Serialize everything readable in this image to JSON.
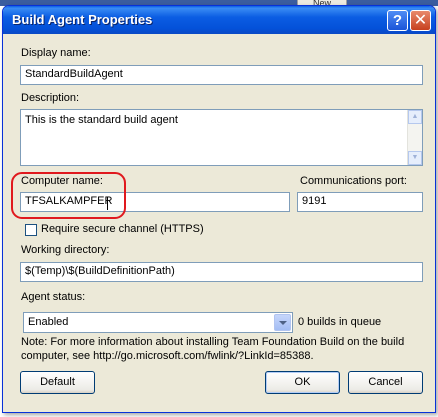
{
  "background": {
    "button_label": "New"
  },
  "titlebar": {
    "title": "Build Agent Properties",
    "help_label": "?",
    "close_label": "✕"
  },
  "display_name": {
    "label": "Display name:",
    "value": "StandardBuildAgent"
  },
  "description": {
    "label": "Description:",
    "value": "This is the standard build agent"
  },
  "computer_name": {
    "label": "Computer name:",
    "value": "TFSALKAMPFER"
  },
  "communications_port": {
    "label": "Communications port:",
    "value": "9191"
  },
  "secure_channel": {
    "label": "Require secure channel (HTTPS)",
    "checked": false
  },
  "working_directory": {
    "label": "Working directory:",
    "value": "$(Temp)\\$(BuildDefinitionPath)"
  },
  "agent_status": {
    "label": "Agent status:",
    "value": "Enabled",
    "queue_text": "0 builds in queue"
  },
  "note": {
    "line1": "Note: For more information about installing Team Foundation Build on the build",
    "line2": "computer, see http://go.microsoft.com/fwlink/?LinkId=85388."
  },
  "buttons": {
    "default": "Default",
    "ok": "OK",
    "cancel": "Cancel"
  },
  "colors": {
    "titlebar": "#0451d9",
    "dialog_bg": "#ece9d8",
    "highlight": "#e0191e",
    "field_border": "#7f9db9"
  }
}
